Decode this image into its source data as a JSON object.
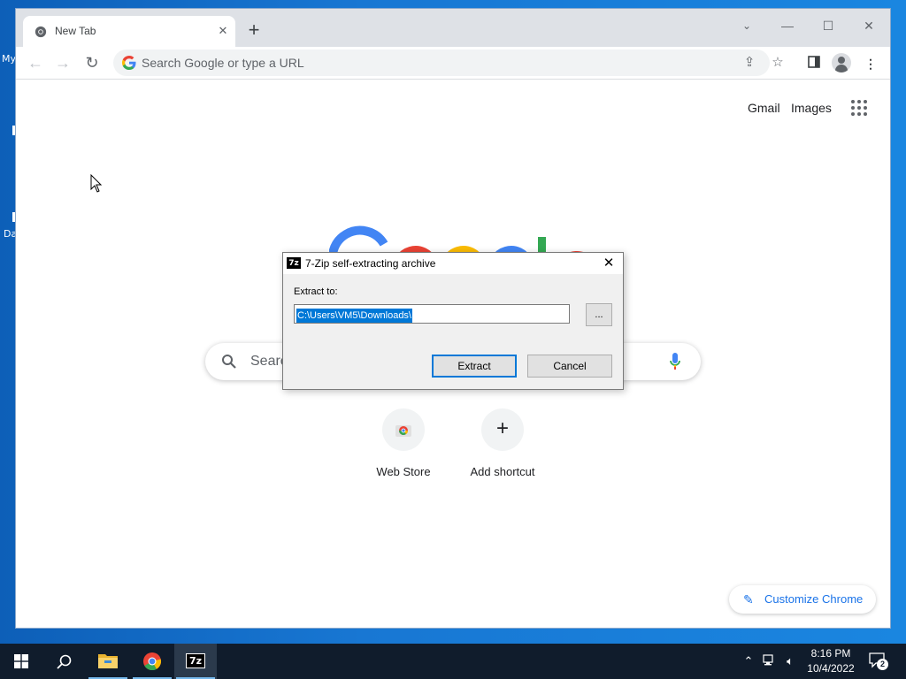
{
  "desktop": {
    "icon_label_1": "My",
    "icon_label_2": "Da"
  },
  "browser": {
    "tab_title": "New Tab",
    "omnibox_placeholder": "Search Google or type a URL",
    "new_tab_page": {
      "link_gmail": "Gmail",
      "link_images": "Images",
      "search_placeholder": "Search",
      "shortcuts": [
        {
          "label": "Web Store"
        },
        {
          "label": "Add shortcut"
        }
      ],
      "customize_label": "Customize Chrome"
    }
  },
  "dialog": {
    "icon_text": "7z",
    "title": "7-Zip self-extracting archive",
    "extract_to_label": "Extract to:",
    "path_value": "C:\\Users\\VM5\\Downloads\\",
    "browse_label": "...",
    "extract_button": "Extract",
    "cancel_button": "Cancel"
  },
  "taskbar": {
    "app_7z_label": "7z",
    "clock_time": "8:16 PM",
    "clock_date": "10/4/2022",
    "notification_count": "2"
  },
  "colors": {
    "desktop_blue": "#1877d3",
    "selection_blue": "#0078d7",
    "link_blue": "#1a73e8",
    "taskbar": "#101c2c"
  }
}
